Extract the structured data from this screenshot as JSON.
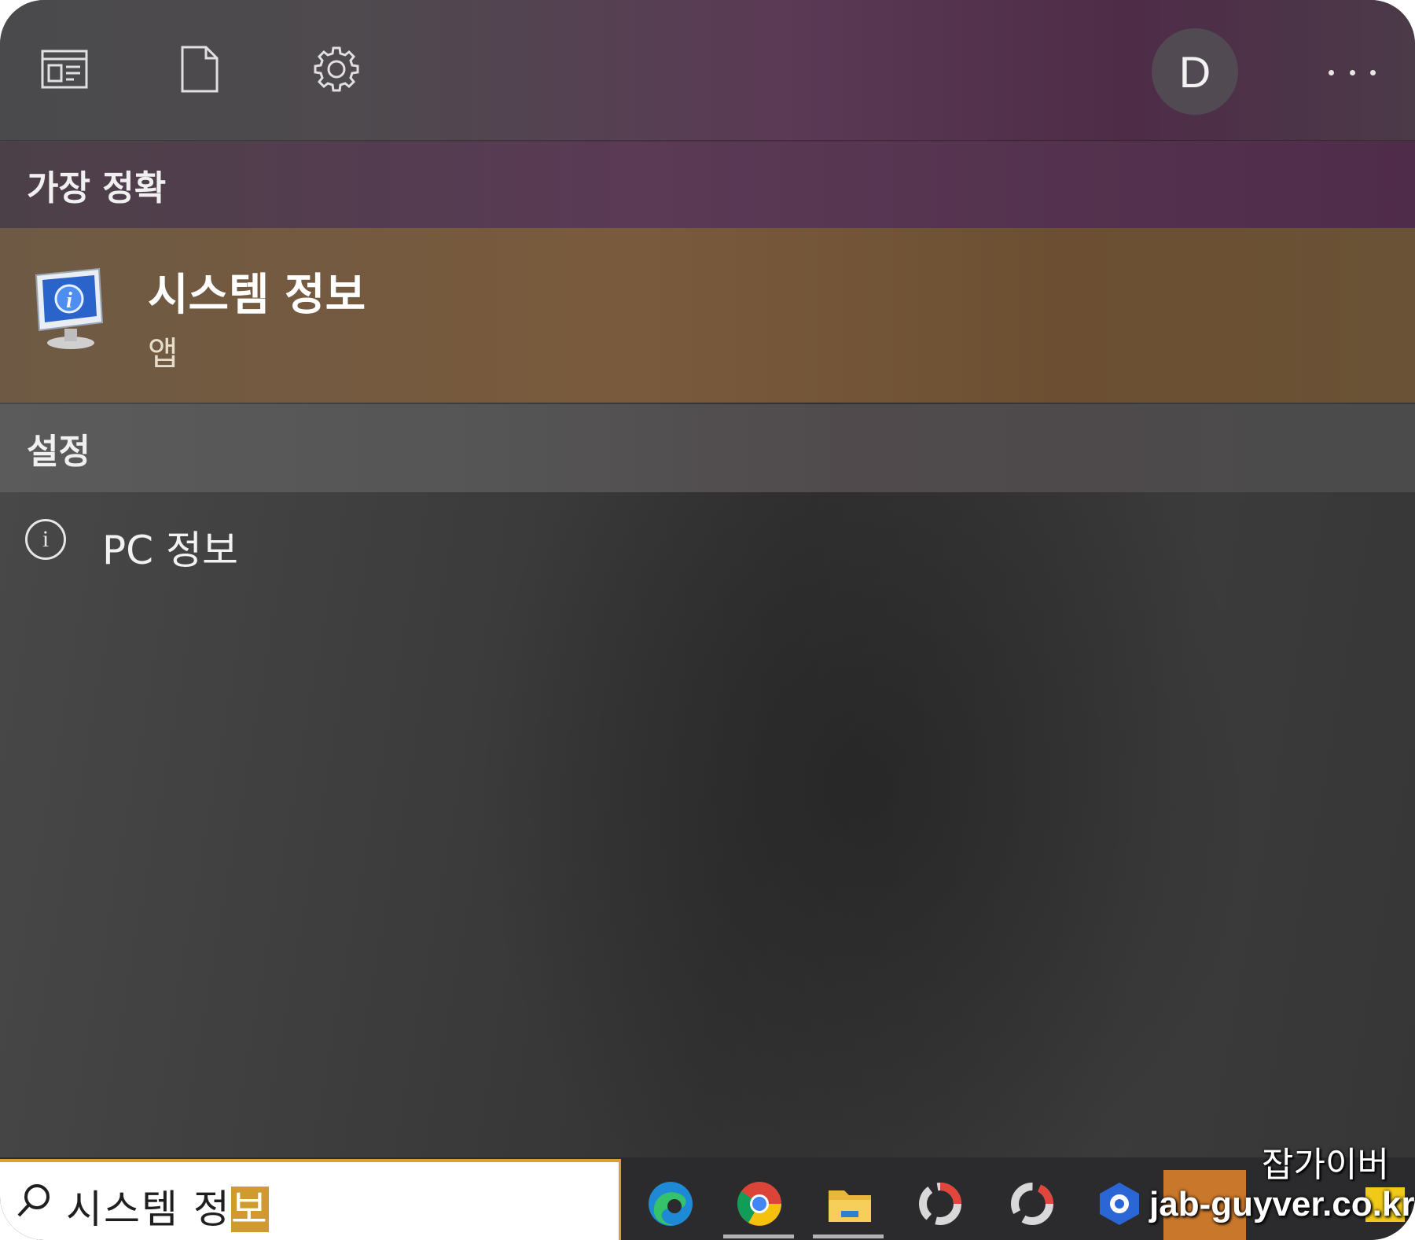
{
  "top_toolbar": {
    "icons": [
      "apps-icon",
      "document-icon",
      "settings-icon"
    ],
    "avatar_letter": "D",
    "more_icon": "ellipsis-icon"
  },
  "sections": {
    "best_match": {
      "heading": "가장 정확",
      "item": {
        "title": "시스템 정보",
        "subtitle": "앱",
        "icon": "system-information-app-icon"
      }
    },
    "settings": {
      "heading": "설정",
      "items": [
        {
          "label": "PC 정보",
          "icon": "info-circle-icon"
        }
      ]
    }
  },
  "taskbar": {
    "search": {
      "typed_text": "시스템 정",
      "selected_text": "보",
      "icon": "search-icon"
    },
    "apps": [
      "edge-icon",
      "chrome-icon",
      "file-explorer-icon",
      "recorder-icon",
      "obs-icon",
      "pinned-app-icon",
      "file-manager-icon",
      "taskbar-app-icon"
    ]
  },
  "watermark": {
    "line1": "잡가이버",
    "line2": "jab-guyver.co.kr"
  },
  "colors": {
    "accent": "#d9a132",
    "best_match_bg": "#74583c",
    "header_purple": "#5a3a55"
  }
}
